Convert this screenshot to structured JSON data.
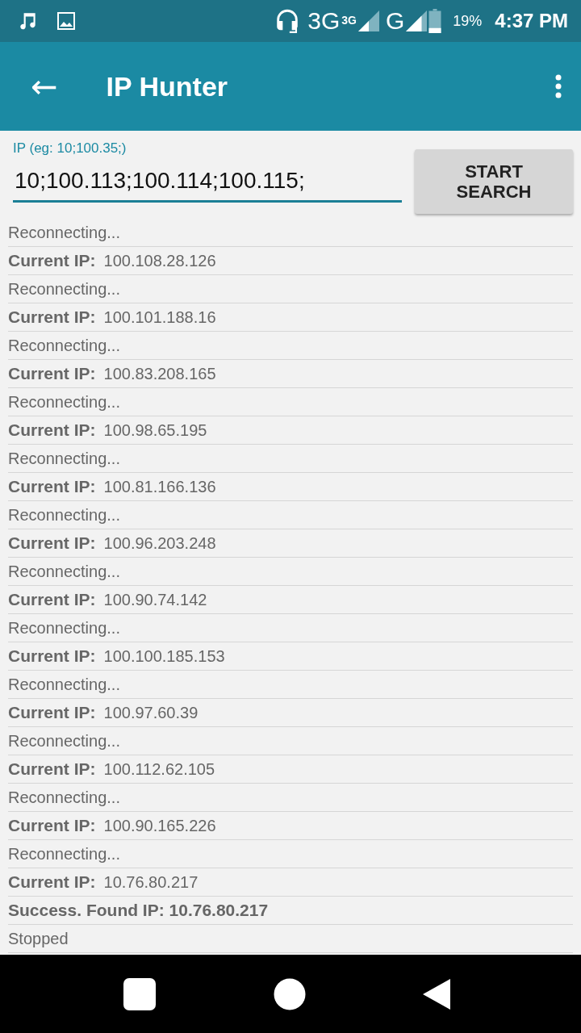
{
  "status_bar": {
    "network": "3G",
    "network_badge": "3G",
    "network2": "G",
    "battery": "19%",
    "time": "4:37 PM"
  },
  "app_bar": {
    "back_icon": "←",
    "title": "IP Hunter"
  },
  "ip_field": {
    "label": "IP (eg: 10;100.35;)",
    "value": "10;100.113;100.114;100.115;"
  },
  "start_button": "START SEARCH",
  "log": [
    {
      "kind": "status",
      "text": "Reconnecting..."
    },
    {
      "kind": "ip",
      "label": "Current IP:",
      "value": "100.108.28.126"
    },
    {
      "kind": "status",
      "text": "Reconnecting..."
    },
    {
      "kind": "ip",
      "label": "Current IP:",
      "value": "100.101.188.16"
    },
    {
      "kind": "status",
      "text": "Reconnecting..."
    },
    {
      "kind": "ip",
      "label": "Current IP:",
      "value": "100.83.208.165"
    },
    {
      "kind": "status",
      "text": "Reconnecting..."
    },
    {
      "kind": "ip",
      "label": "Current IP:",
      "value": "100.98.65.195"
    },
    {
      "kind": "status",
      "text": "Reconnecting..."
    },
    {
      "kind": "ip",
      "label": "Current IP:",
      "value": "100.81.166.136"
    },
    {
      "kind": "status",
      "text": "Reconnecting..."
    },
    {
      "kind": "ip",
      "label": "Current IP:",
      "value": "100.96.203.248"
    },
    {
      "kind": "status",
      "text": "Reconnecting..."
    },
    {
      "kind": "ip",
      "label": "Current IP:",
      "value": "100.90.74.142"
    },
    {
      "kind": "status",
      "text": "Reconnecting..."
    },
    {
      "kind": "ip",
      "label": "Current IP:",
      "value": "100.100.185.153"
    },
    {
      "kind": "status",
      "text": "Reconnecting..."
    },
    {
      "kind": "ip",
      "label": "Current IP:",
      "value": "100.97.60.39"
    },
    {
      "kind": "status",
      "text": "Reconnecting..."
    },
    {
      "kind": "ip",
      "label": "Current IP:",
      "value": "100.112.62.105"
    },
    {
      "kind": "status",
      "text": "Reconnecting..."
    },
    {
      "kind": "ip",
      "label": "Current IP:",
      "value": "100.90.165.226"
    },
    {
      "kind": "status",
      "text": "Reconnecting..."
    },
    {
      "kind": "ip",
      "label": "Current IP:",
      "value": "10.76.80.217"
    },
    {
      "kind": "success",
      "text": "Success. Found IP: 10.76.80.217"
    },
    {
      "kind": "status",
      "text": "Stopped"
    }
  ]
}
